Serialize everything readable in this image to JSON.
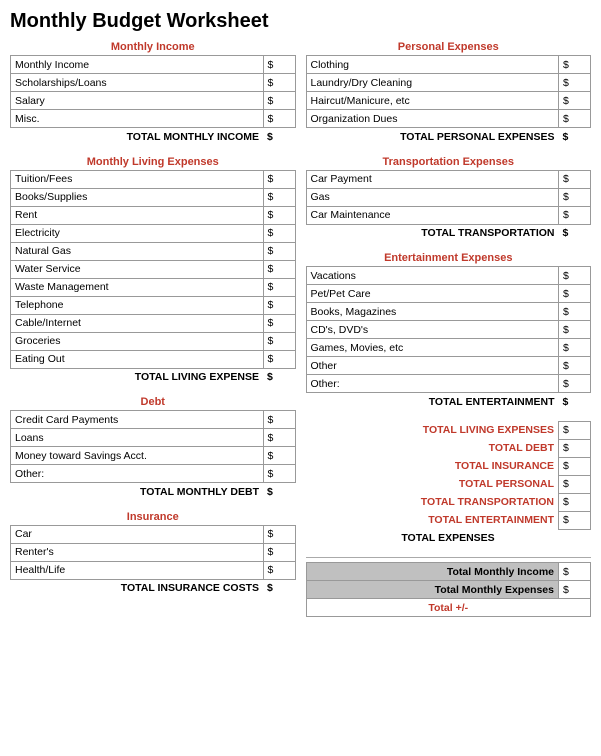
{
  "title": "Monthly Budget Worksheet",
  "left": {
    "monthly_income": {
      "section_title": "Monthly Income",
      "rows": [
        {
          "label": "Monthly Income",
          "value": "$"
        },
        {
          "label": "Scholarships/Loans",
          "value": "$"
        },
        {
          "label": "Salary",
          "value": "$"
        },
        {
          "label": "Misc.",
          "value": "$"
        }
      ],
      "total_label": "TOTAL MONTHLY INCOME",
      "total_value": "$"
    },
    "living_expenses": {
      "section_title": "Monthly Living Expenses",
      "rows": [
        {
          "label": "Tuition/Fees",
          "value": "$"
        },
        {
          "label": "Books/Supplies",
          "value": "$"
        },
        {
          "label": "Rent",
          "value": "$"
        },
        {
          "label": "Electricity",
          "value": "$"
        },
        {
          "label": "Natural Gas",
          "value": "$"
        },
        {
          "label": "Water Service",
          "value": "$"
        },
        {
          "label": "Waste Management",
          "value": "$"
        },
        {
          "label": "Telephone",
          "value": "$"
        },
        {
          "label": "Cable/Internet",
          "value": "$"
        },
        {
          "label": "Groceries",
          "value": "$"
        },
        {
          "label": "Eating Out",
          "value": "$"
        }
      ],
      "total_label": "TOTAL LIVING EXPENSE",
      "total_value": "$"
    },
    "debt": {
      "section_title": "Debt",
      "rows": [
        {
          "label": "Credit Card Payments",
          "value": "$"
        },
        {
          "label": "Loans",
          "value": "$"
        },
        {
          "label": "Money toward Savings Acct.",
          "value": "$"
        },
        {
          "label": "Other:",
          "value": "$"
        }
      ],
      "total_label": "TOTAL MONTHLY DEBT",
      "total_value": "$"
    },
    "insurance": {
      "section_title": "Insurance",
      "rows": [
        {
          "label": "Car",
          "value": "$"
        },
        {
          "label": "Renter's",
          "value": "$"
        },
        {
          "label": "Health/Life",
          "value": "$"
        }
      ],
      "total_label": "TOTAL INSURANCE COSTS",
      "total_value": "$"
    }
  },
  "right": {
    "personal_expenses": {
      "section_title": "Personal Expenses",
      "rows": [
        {
          "label": "Clothing",
          "value": "$"
        },
        {
          "label": "Laundry/Dry Cleaning",
          "value": "$"
        },
        {
          "label": "Haircut/Manicure, etc",
          "value": "$"
        },
        {
          "label": "Organization Dues",
          "value": "$"
        }
      ],
      "total_label": "TOTAL PERSONAL EXPENSES",
      "total_value": "$"
    },
    "transportation": {
      "section_title": "Transportation Expenses",
      "rows": [
        {
          "label": "Car Payment",
          "value": "$"
        },
        {
          "label": "Gas",
          "value": "$"
        },
        {
          "label": "Car Maintenance",
          "value": "$"
        }
      ],
      "total_label": "TOTAL TRANSPORTATION",
      "total_value": "$"
    },
    "entertainment": {
      "section_title": "Entertainment Expenses",
      "rows": [
        {
          "label": "Vacations",
          "value": "$"
        },
        {
          "label": "Pet/Pet Care",
          "value": "$"
        },
        {
          "label": "Books, Magazines",
          "value": "$"
        },
        {
          "label": "CD's, DVD's",
          "value": "$"
        },
        {
          "label": "Games, Movies, etc",
          "value": "$"
        },
        {
          "label": "Other",
          "value": "$"
        },
        {
          "label": "Other:",
          "value": "$"
        }
      ],
      "total_label": "TOTAL ENTERTAINMENT",
      "total_value": "$"
    },
    "summary": {
      "rows": [
        {
          "label": "TOTAL LIVING EXPENSES",
          "value": "$"
        },
        {
          "label": "TOTAL DEBT",
          "value": "$"
        },
        {
          "label": "TOTAL INSURANCE",
          "value": "$"
        },
        {
          "label": "TOTAL PERSONAL",
          "value": "$"
        },
        {
          "label": "TOTAL TRANSPORTATION",
          "value": "$"
        },
        {
          "label": "TOTAL ENTERTAINMENT",
          "value": "$"
        }
      ],
      "grand_total_label": "TOTAL EXPENSES"
    }
  },
  "bottom": {
    "rows": [
      {
        "label": "Total Monthly Income",
        "value": "$"
      },
      {
        "label": "Total Monthly Expenses",
        "value": "$"
      }
    ],
    "total_label": "Total +/-"
  }
}
